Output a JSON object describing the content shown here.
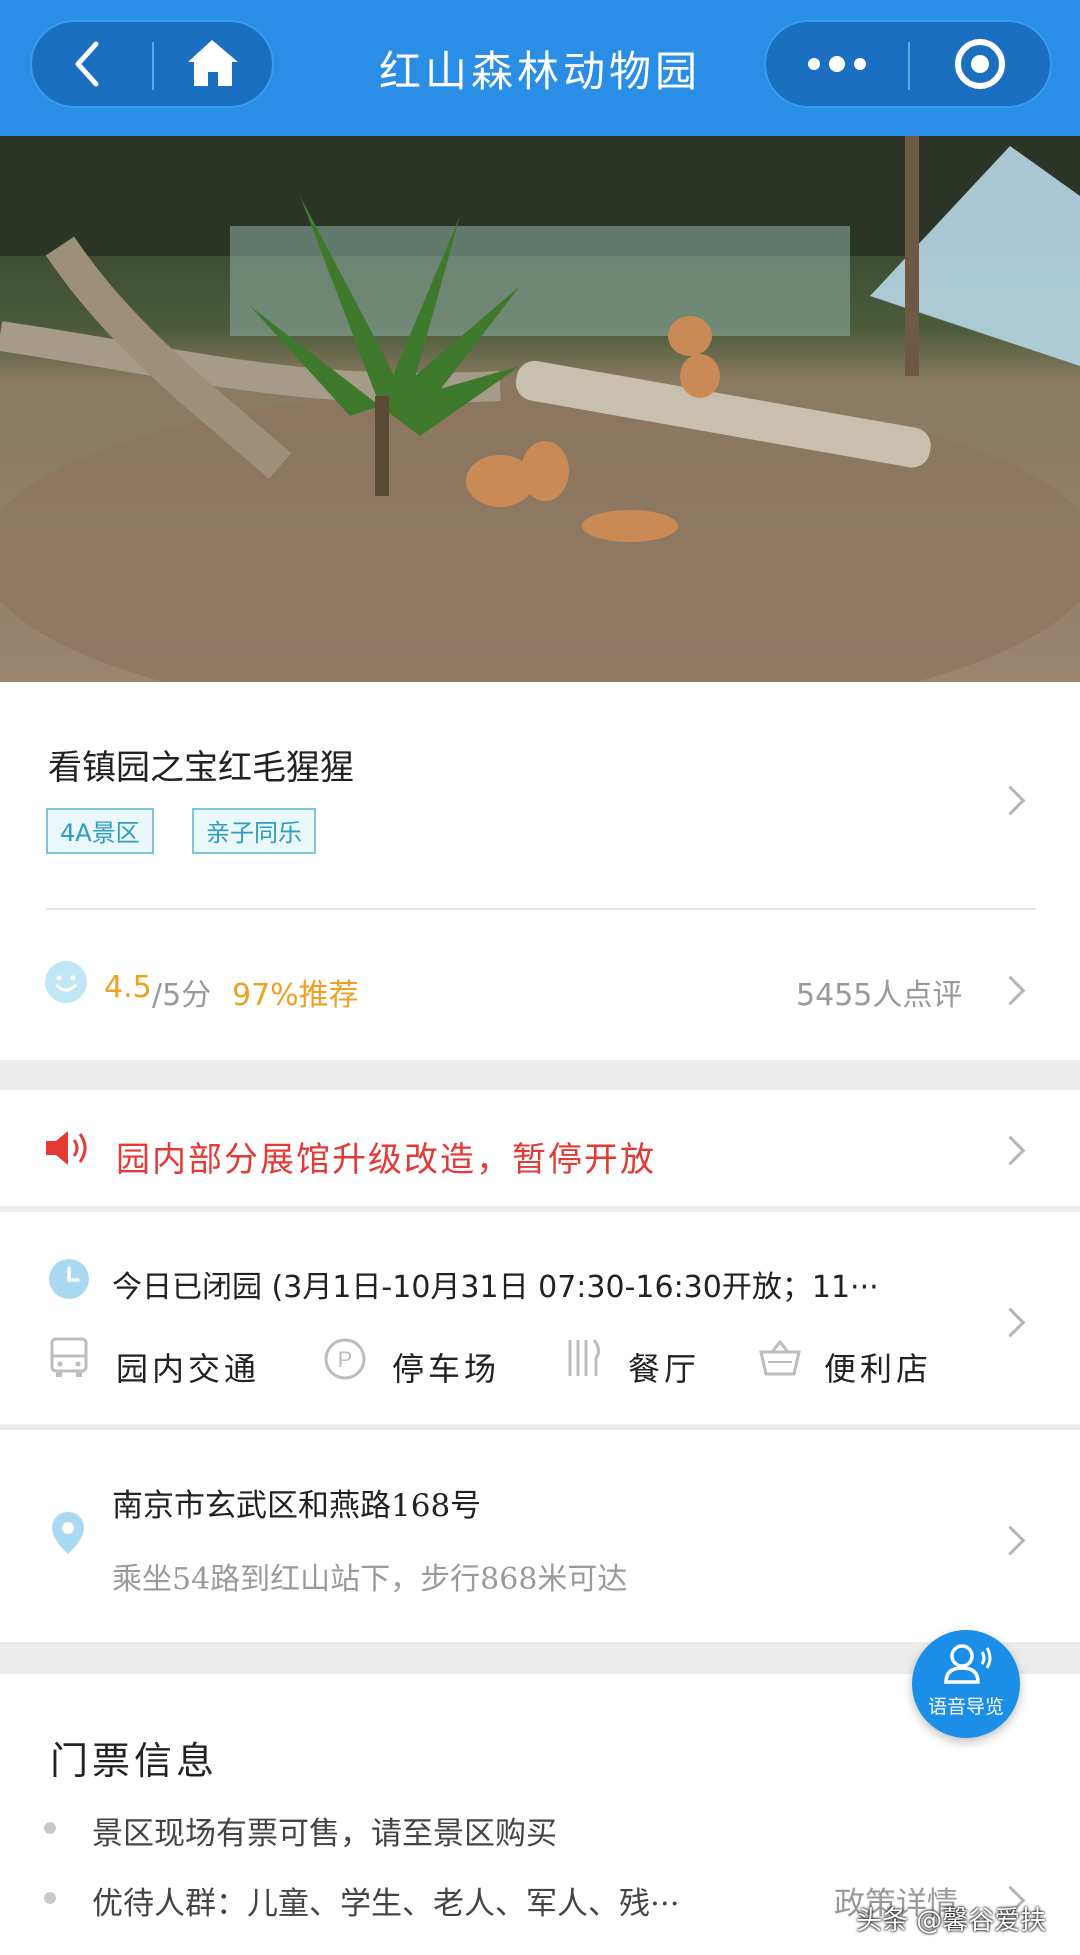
{
  "header": {
    "title": "红山森林动物园",
    "back_icon": "chevron-left-icon",
    "home_icon": "home-icon",
    "more_icon": "more-dots-icon",
    "close_icon": "target-circle-icon"
  },
  "attraction": {
    "title": "看镇园之宝红毛猩猩",
    "tags": [
      "4A景区",
      "亲子同乐"
    ]
  },
  "rating": {
    "score": "4.5",
    "max": "/5分",
    "recommend": "97%推荐",
    "reviews": "5455人点评"
  },
  "notice": {
    "text": "园内部分展馆升级改造，暂停开放"
  },
  "hours": {
    "text": "今日已闭园 (3月1日-10月31日 07:30-16:30开放；11···"
  },
  "facilities": [
    "园内交通",
    "停车场",
    "餐厅",
    "便利店"
  ],
  "address": {
    "main": "南京市玄武区和燕路168号",
    "sub": "乘坐54路到红山站下，步行868米可达"
  },
  "tickets": {
    "title": "门票信息",
    "lines": [
      "景区现场有票可售，请至景区购买",
      "优待人群：儿童、学生、老人、军人、残···"
    ],
    "policy_link": "政策详情"
  },
  "voice_guide": {
    "label": "语音导览"
  },
  "watermark": "头条 @馨谷爱扶",
  "colors": {
    "header": "#2a8ee6",
    "notice_red": "#e53935",
    "score_orange": "#f0a020",
    "tag_blue": "#2c9cc0"
  }
}
